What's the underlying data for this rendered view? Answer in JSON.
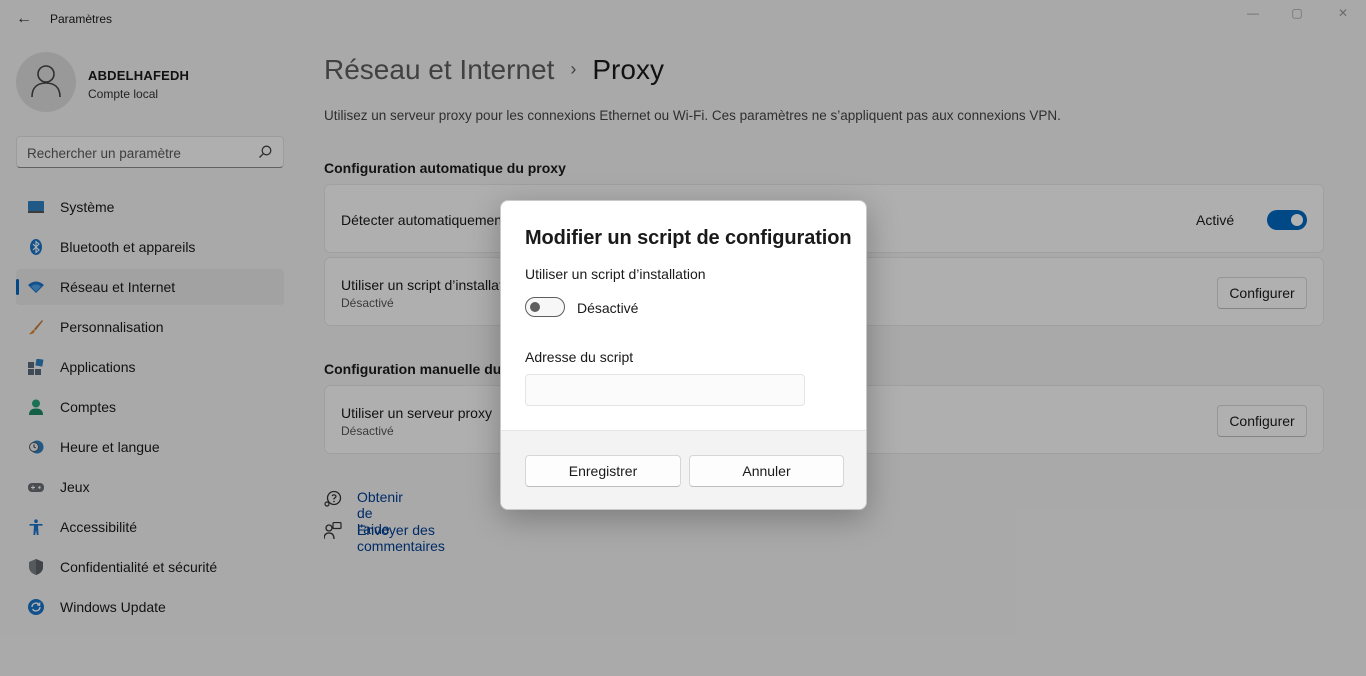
{
  "window": {
    "title": "Paramètres",
    "back_glyph": "←",
    "minimize_glyph": "—",
    "maximize_glyph": "▢",
    "close_glyph": "✕"
  },
  "profile": {
    "name": "ABDELHAFEDH",
    "account": "Compte local"
  },
  "search": {
    "placeholder": "Rechercher un paramètre"
  },
  "sidebar": {
    "items": [
      {
        "label": "Système",
        "icon": "monitor-icon",
        "active": false
      },
      {
        "label": "Bluetooth et appareils",
        "icon": "bluetooth-icon",
        "active": false
      },
      {
        "label": "Réseau et Internet",
        "icon": "wifi-icon",
        "active": true
      },
      {
        "label": "Personnalisation",
        "icon": "brush-icon",
        "active": false
      },
      {
        "label": "Applications",
        "icon": "apps-icon",
        "active": false
      },
      {
        "label": "Comptes",
        "icon": "person-icon",
        "active": false
      },
      {
        "label": "Heure et langue",
        "icon": "clock-globe-icon",
        "active": false
      },
      {
        "label": "Jeux",
        "icon": "gamepad-icon",
        "active": false
      },
      {
        "label": "Accessibilité",
        "icon": "accessibility-icon",
        "active": false
      },
      {
        "label": "Confidentialité et sécurité",
        "icon": "shield-icon",
        "active": false
      },
      {
        "label": "Windows Update",
        "icon": "update-icon",
        "active": false
      }
    ]
  },
  "main": {
    "breadcrumb_parent": "Réseau et Internet",
    "breadcrumb_sep": "›",
    "breadcrumb_current": "Proxy",
    "description": "Utilisez un serveur proxy pour les connexions Ethernet ou Wi-Fi. Ces paramètres ne s’appliquent pas aux connexions VPN.",
    "auto_section": "Configuration automatique du proxy",
    "auto_detect": {
      "title": "Détecter automatiquement les paramètres",
      "state": "Activé"
    },
    "setup_script": {
      "title": "Utiliser un script d’installation",
      "sub": "Désactivé",
      "button": "Configurer"
    },
    "manual_section": "Configuration manuelle du proxy",
    "manual_proxy": {
      "title": "Utiliser un serveur proxy",
      "sub": "Désactivé",
      "button": "Configurer"
    },
    "help_link": "Obtenir de l’aide",
    "feedback_link": "Envoyer des commentaires"
  },
  "dialog": {
    "title": "Modifier un script de configuration",
    "toggle_label": "Utiliser un script d’installation",
    "toggle_state": "Désactivé",
    "address_label": "Adresse du script",
    "address_value": "",
    "save_button": "Enregistrer",
    "cancel_button": "Annuler"
  },
  "colors": {
    "accent": "#0067c0",
    "link": "#003e92",
    "background": "#f3f3f3"
  }
}
